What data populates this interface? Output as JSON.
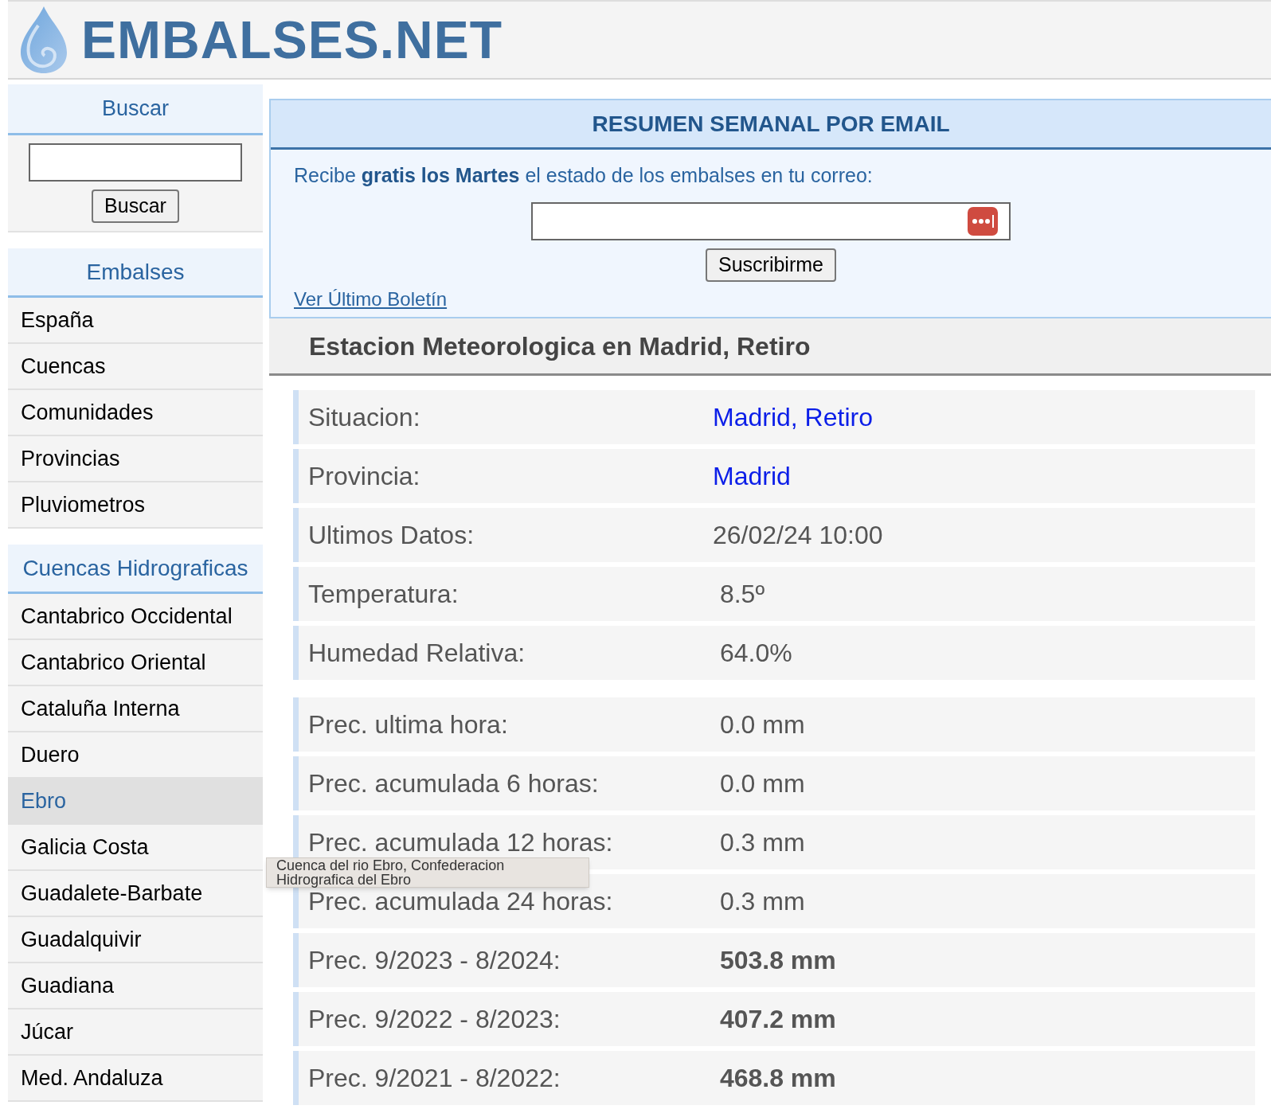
{
  "logo": {
    "text": "EMBALSES.NET"
  },
  "search": {
    "title": "Buscar",
    "button": "Buscar"
  },
  "sidebar": [
    {
      "title": "Embalses",
      "items": [
        {
          "label": "España",
          "selected": false
        },
        {
          "label": "Cuencas",
          "selected": false
        },
        {
          "label": "Comunidades",
          "selected": false
        },
        {
          "label": "Provincias",
          "selected": false
        },
        {
          "label": "Pluviometros",
          "selected": false
        }
      ]
    },
    {
      "title": "Cuencas Hidrograficas",
      "items": [
        {
          "label": "Cantabrico Occidental",
          "selected": false
        },
        {
          "label": "Cantabrico Oriental",
          "selected": false
        },
        {
          "label": "Cataluña Interna",
          "selected": false
        },
        {
          "label": "Duero",
          "selected": false
        },
        {
          "label": "Ebro",
          "selected": true
        },
        {
          "label": "Galicia Costa",
          "selected": false
        },
        {
          "label": "Guadalete-Barbate",
          "selected": false
        },
        {
          "label": "Guadalquivir",
          "selected": false
        },
        {
          "label": "Guadiana",
          "selected": false
        },
        {
          "label": "Júcar",
          "selected": false
        },
        {
          "label": "Med. Andaluza",
          "selected": false
        }
      ]
    }
  ],
  "newsletter": {
    "title": "RESUMEN SEMANAL POR EMAIL",
    "text": "Recibe **gratis los Martes** el estado de los embalses en tu correo:",
    "button": "Suscribirme",
    "link": "Ver Último Boletín"
  },
  "station": {
    "title": "Estacion Meteorologica en Madrid, Retiro",
    "groups": [
      [
        {
          "label": "Situacion:",
          "value": "Madrid, Retiro",
          "kind": "link"
        },
        {
          "label": "Provincia:",
          "value": "Madrid",
          "kind": "link"
        },
        {
          "label": "Ultimos Datos:",
          "value": "26/02/24 10:00",
          "kind": "plain"
        },
        {
          "label": "Temperatura:",
          "value": " 8.5º",
          "kind": "plain"
        },
        {
          "label": "Humedad Relativa:",
          "value": " 64.0%",
          "kind": "plain"
        }
      ],
      [
        {
          "label": "Prec. ultima hora:",
          "value": " 0.0 mm",
          "kind": "plain"
        },
        {
          "label": "Prec. acumulada 6 horas:",
          "value": " 0.0 mm",
          "kind": "plain"
        },
        {
          "label": "Prec. acumulada 12 horas:",
          "value": " 0.3 mm",
          "kind": "plain"
        },
        {
          "label": "Prec. acumulada 24 horas:",
          "value": " 0.3 mm",
          "kind": "plain"
        },
        {
          "label": "Prec. 9/2023 - 8/2024:",
          "value": " 503.8 mm",
          "kind": "bold"
        },
        {
          "label": "Prec. 9/2022 - 8/2023:",
          "value": " 407.2 mm",
          "kind": "bold"
        },
        {
          "label": "Prec. 9/2021 - 8/2022:",
          "value": " 468.8 mm",
          "kind": "bold"
        }
      ]
    ]
  },
  "tooltip": {
    "text": "Cuenca del rio Ebro, Confederacion Hidrografica del Ebro"
  }
}
